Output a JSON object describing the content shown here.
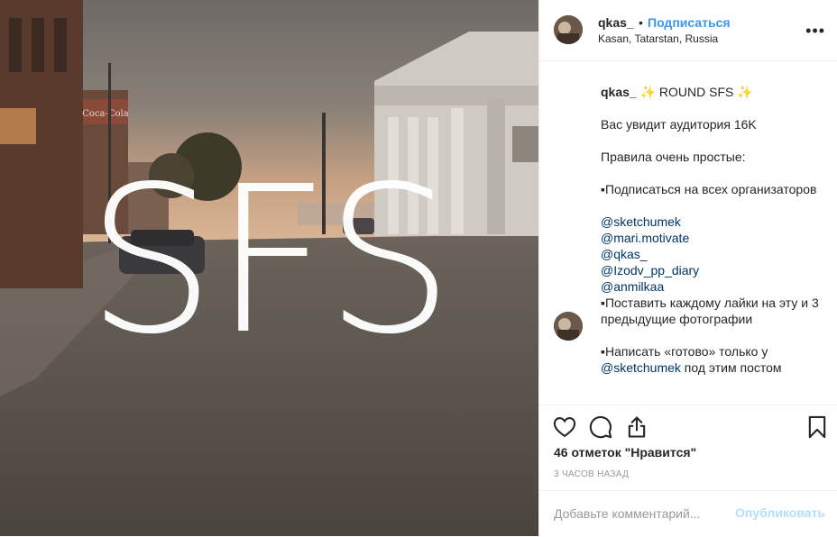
{
  "header": {
    "username": "qkas_",
    "dot": "•",
    "follow_label": "Подписаться",
    "location": "Kasan, Tatarstan, Russia",
    "more_label": "•••"
  },
  "photo": {
    "overlay_text": "SFS",
    "sign_text": "Coca-Cola"
  },
  "caption": {
    "author": "qkas_",
    "title": " ✨ ROUND SFS ✨",
    "line_audience": "Вас увидит аудитория 16K",
    "line_rules": "Правила очень простые:",
    "rule1": "▪Подписаться на всех организаторов",
    "mentions": [
      "@sketchumek",
      "@mari.motivate",
      "@qkas_",
      "@Izodv_pp_diary",
      "@anmilkaa"
    ],
    "rule2": "▪Поставить каждому лайки на эту и 3 предыдущие фотографии",
    "rule3_prefix": "▪Написать «готово» только у",
    "rule3_mention": "@sketchumek",
    "rule3_suffix": " под этим постом"
  },
  "stats": {
    "likes": "46 отметок \"Нравится\"",
    "time": "3 ЧАСОВ НАЗАД"
  },
  "comment": {
    "placeholder": "Добавьте комментарий...",
    "post_label": "Опубликовать"
  },
  "icons": {
    "like": "heart-icon",
    "comment": "speech-bubble-icon",
    "share": "share-icon",
    "save": "bookmark-icon",
    "more": "more-dots-icon"
  },
  "colors": {
    "follow": "#3897f0",
    "mention": "#003569",
    "post_disabled": "#b2dffc",
    "muted": "#999999"
  }
}
